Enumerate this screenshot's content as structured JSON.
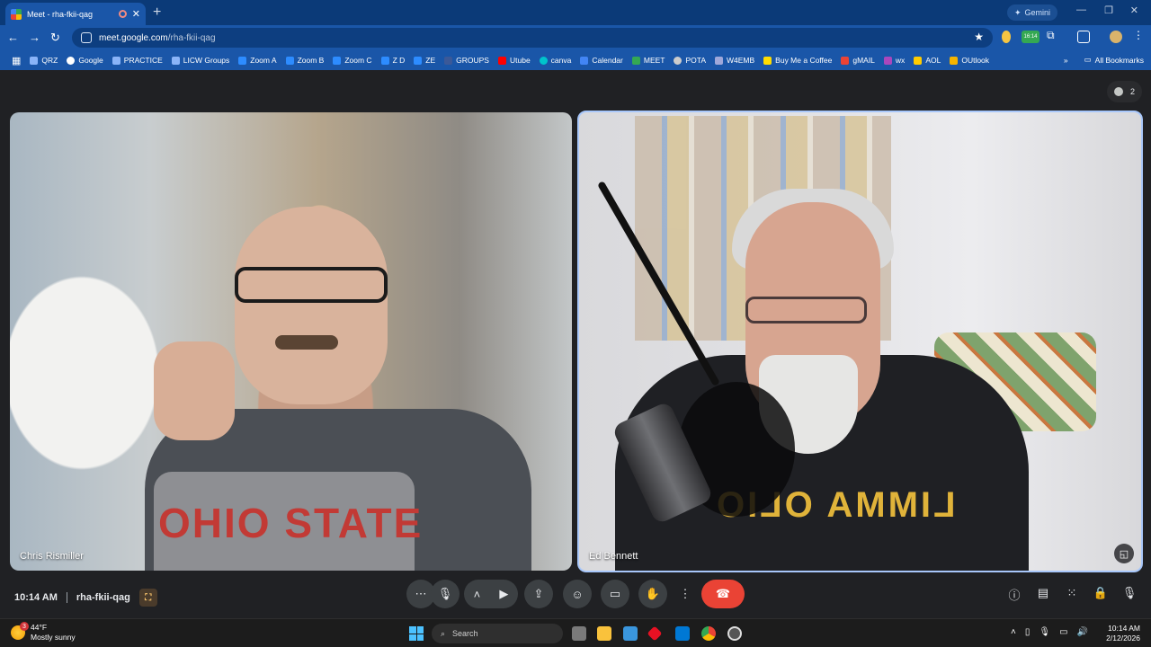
{
  "browser": {
    "tab_title": "Meet - rha-fkii-qag",
    "new_tab_label": "+",
    "gemini_label": "Gemini",
    "url_host": "meet.google.com",
    "url_path": "/rha-fkii-qag",
    "extension_badge": "16:14",
    "bookmarks": [
      "QRZ",
      "Google",
      "PRACTICE",
      "LICW Groups",
      "Zoom A",
      "Zoom B",
      "Zoom C",
      "Z D",
      "ZE",
      "GROUPS",
      "Utube",
      "canva",
      "Calendar",
      "MEET",
      "POTA",
      "W4EMB",
      "Buy Me a Coffee",
      "gMAIL",
      "wx",
      "AOL",
      "OUtlook"
    ],
    "all_bookmarks_label": "All Bookmarks"
  },
  "meet": {
    "participant_count": "2",
    "tiles": [
      {
        "name": "Chris Rismiller",
        "shirt_text": "OHIO STATE"
      },
      {
        "name": "Ed Bennett",
        "shirt_text": "LIMMA OLIO"
      }
    ],
    "time": "10:14 AM",
    "meeting_code": "rha-fkii-qag",
    "colors": {
      "accent": "#a8c7fa",
      "end_call": "#ea4335",
      "background": "#202124"
    }
  },
  "taskbar": {
    "weather_temp": "44°F",
    "weather_desc": "Mostly sunny",
    "weather_badge": "3",
    "search_placeholder": "Search",
    "clock_time": "10:14 AM",
    "clock_date": "2/12/2026"
  }
}
